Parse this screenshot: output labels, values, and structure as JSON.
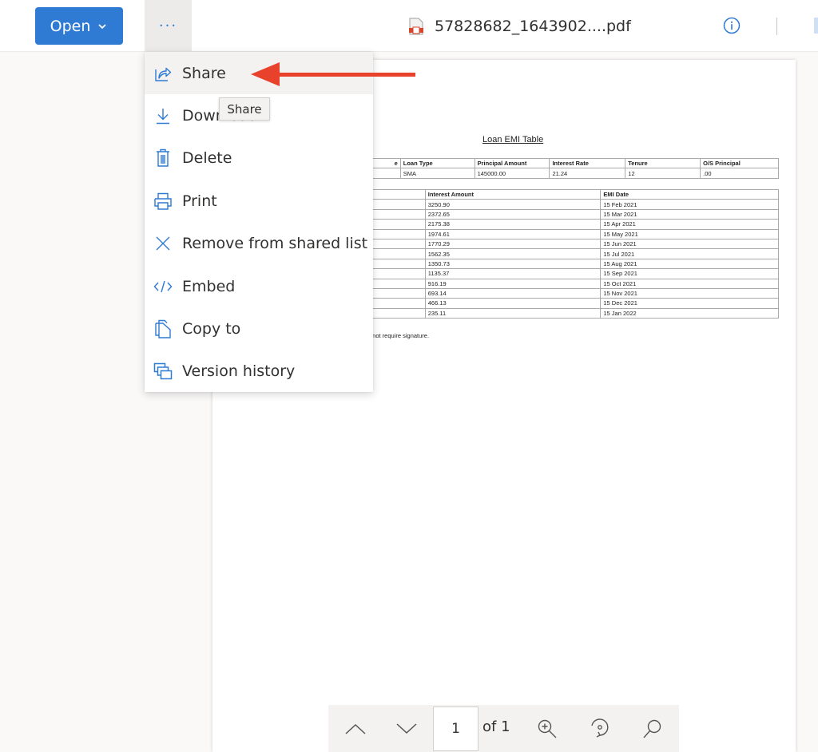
{
  "toolbar": {
    "open_label": "Open",
    "more_label": "···",
    "file_name": "57828682_1643902....pdf",
    "info_icon": "info-icon"
  },
  "menu": {
    "items": [
      {
        "label": "Share",
        "icon": "share-icon"
      },
      {
        "label": "Download",
        "icon": "download-icon"
      },
      {
        "label": "Delete",
        "icon": "trash-icon"
      },
      {
        "label": "Print",
        "icon": "printer-icon"
      },
      {
        "label": "Remove from shared list",
        "icon": "close-icon"
      },
      {
        "label": "Embed",
        "icon": "code-icon"
      },
      {
        "label": "Copy to",
        "icon": "copy-icon"
      },
      {
        "label": "Version history",
        "icon": "version-history-icon"
      }
    ],
    "tooltip": "Share"
  },
  "annotation": {
    "arrow_color": "#e8412c"
  },
  "document": {
    "title": "Loan EMI Table",
    "summary_table": {
      "headers": [
        "e",
        "Loan Type",
        "Principal Amount",
        "Interest Rate",
        "Tenure",
        "O/S Principal"
      ],
      "row": [
        "",
        "SMA",
        "145000.00",
        "21.24",
        "12",
        ".00"
      ]
    },
    "schedule_table": {
      "headers": [
        "",
        "Interest Amount",
        "EMI Date"
      ],
      "rows": [
        [
          "",
          "3250.90",
          "15 Feb 2021"
        ],
        [
          "",
          "2372.65",
          "15 Mar 2021"
        ],
        [
          "",
          "2175.38",
          "15 Apr 2021"
        ],
        [
          "",
          "1974.61",
          "15 May 2021"
        ],
        [
          "",
          "1770.29",
          "15 Jun 2021"
        ],
        [
          "",
          "1562.35",
          "15 Jul 2021"
        ],
        [
          "",
          "1350.73",
          "15 Aug 2021"
        ],
        [
          "",
          "1135.37",
          "15 Sep 2021"
        ],
        [
          "",
          "916.19",
          "15 Oct 2021"
        ],
        [
          "",
          "693.14",
          "15 Nov 2021"
        ],
        [
          "",
          "466.13",
          "15 Dec 2021"
        ],
        [
          "",
          "235.11",
          "15 Jan 2022"
        ]
      ]
    },
    "note": "oes not require signature."
  },
  "pager": {
    "current_page": "1",
    "of_label": "of 1"
  },
  "colors": {
    "accent": "#2f7bd3",
    "pdf_icon": "#d9442c"
  }
}
